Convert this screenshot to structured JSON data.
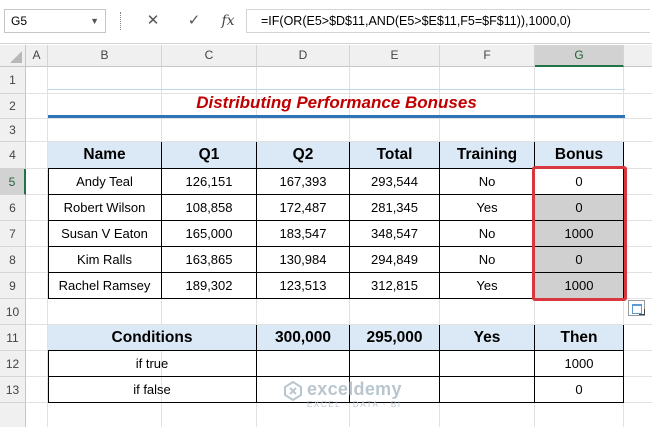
{
  "formula_bar": {
    "name_box": "G5",
    "cancel_glyph": "✕",
    "enter_glyph": "✓",
    "fx_glyph": "fx",
    "formula": "=IF(OR(E5>$D$11,AND(E5>$E$11,F5=$F$11)),1000,0)"
  },
  "columns": [
    "A",
    "B",
    "C",
    "D",
    "E",
    "F",
    "G"
  ],
  "rows": [
    "1",
    "2",
    "3",
    "4",
    "5",
    "6",
    "7",
    "8",
    "9",
    "10",
    "11",
    "12",
    "13"
  ],
  "selected_cell": "G5",
  "title": "Distributing Performance Bonuses",
  "main_table": {
    "headers": [
      "Name",
      "Q1",
      "Q2",
      "Total",
      "Training",
      "Bonus"
    ],
    "rows": [
      [
        "Andy Teal",
        "126,151",
        "167,393",
        "293,544",
        "No",
        "0"
      ],
      [
        "Robert Wilson",
        "108,858",
        "172,487",
        "281,345",
        "Yes",
        "0"
      ],
      [
        "Susan V Eaton",
        "165,000",
        "183,547",
        "348,547",
        "No",
        "1000"
      ],
      [
        "Kim Ralls",
        "163,865",
        "130,984",
        "294,849",
        "No",
        "0"
      ],
      [
        "Rachel Ramsey",
        "189,302",
        "123,513",
        "312,815",
        "Yes",
        "1000"
      ]
    ]
  },
  "conditions_table": {
    "headers": [
      "Conditions",
      "300,000",
      "295,000",
      "Yes",
      "Then"
    ],
    "rows": [
      [
        "if true",
        "",
        "",
        "",
        "1000"
      ],
      [
        "if false",
        "",
        "",
        "",
        "0"
      ]
    ]
  },
  "watermark": {
    "name": "exceldemy",
    "tagline": "EXCEL · DATA · BI"
  },
  "colors": {
    "title": "#c00000",
    "title_underline": "#2e75b6",
    "header_fill": "#dbe8f5",
    "bonus_fill": "#d0d0d0",
    "highlight": "#d9363e",
    "excel_green": "#217346"
  }
}
